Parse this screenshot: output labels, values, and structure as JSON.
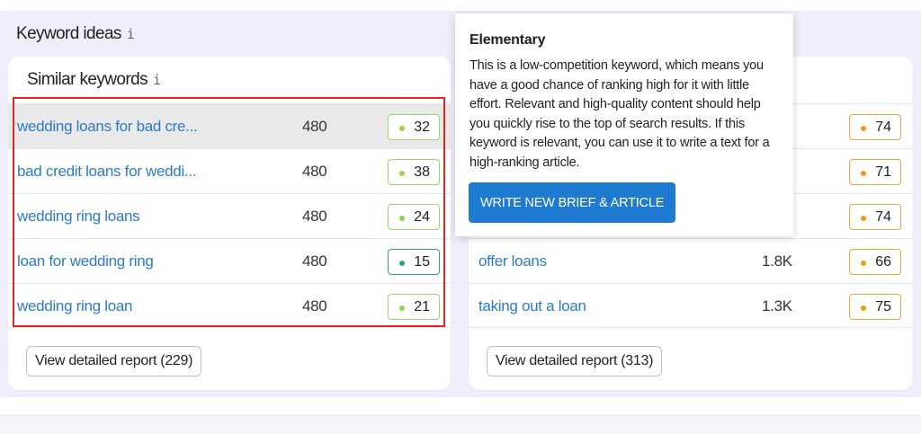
{
  "section": {
    "title": "Keyword ideas",
    "info": "i"
  },
  "left_card": {
    "title": "Similar keywords",
    "info": "i",
    "rows": [
      {
        "keyword": "wedding loans for bad cre...",
        "volume": "480",
        "score": "32",
        "level": "green"
      },
      {
        "keyword": "bad credit loans for weddi...",
        "volume": "480",
        "score": "38",
        "level": "green"
      },
      {
        "keyword": "wedding ring loans",
        "volume": "480",
        "score": "24",
        "level": "green"
      },
      {
        "keyword": "loan for wedding ring",
        "volume": "480",
        "score": "15",
        "level": "teal"
      },
      {
        "keyword": "wedding ring loan",
        "volume": "480",
        "score": "21",
        "level": "green"
      }
    ],
    "report_button": "View detailed report (229)"
  },
  "right_card": {
    "rows": [
      {
        "keyword": "",
        "volume": "",
        "score": "74",
        "level": "orange"
      },
      {
        "keyword": "",
        "volume": "",
        "score": "71",
        "level": "orange"
      },
      {
        "keyword": "",
        "volume": "",
        "score": "74",
        "level": "orange"
      },
      {
        "keyword": "offer loans",
        "volume": "1.8K",
        "score": "66",
        "level": "orange"
      },
      {
        "keyword": "taking out a loan",
        "volume": "1.3K",
        "score": "75",
        "level": "orange"
      }
    ],
    "report_button": "View detailed report (313)"
  },
  "tooltip": {
    "title": "Elementary",
    "body": "This is a low-competition keyword, which means you have a good chance of ranking high for it with little effort. Relevant and high-quality content should help you quickly rise to the top of search results. If this keyword is relevant, you can use it to write a text for a high-ranking article.",
    "button": "WRITE NEW BRIEF & ARTICLE"
  },
  "colors": {
    "link": "#2b7bc9",
    "green": "#8fd64a",
    "teal": "#2aa57a",
    "orange": "#f29a1c",
    "accent_button": "#1f7bd2",
    "highlight": "#e52424"
  }
}
